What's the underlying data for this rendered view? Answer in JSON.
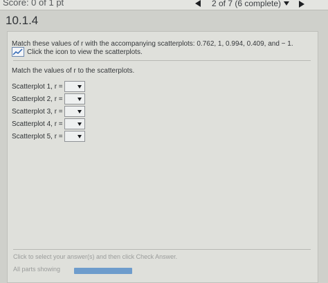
{
  "header": {
    "score_text": "Score: 0 of 1 pt",
    "progress": "2 of 7 (6 complete)"
  },
  "question": {
    "number": "10.1.4",
    "instruction": "Match these values of r with the accompanying scatterplots: 0.762, 1, 0.994, 0.409, and − 1.",
    "icon_label": "Click the icon to view the scatterplots.",
    "match_label": "Match the values of r to the scatterplots.",
    "rows": [
      {
        "label": "Scatterplot 1, r ="
      },
      {
        "label": "Scatterplot 2, r ="
      },
      {
        "label": "Scatterplot 3, r ="
      },
      {
        "label": "Scatterplot 4, r ="
      },
      {
        "label": "Scatterplot 5, r ="
      }
    ]
  },
  "footer": {
    "hint": "Click to select your answer(s) and then click Check Answer.",
    "parts": "All parts showing"
  },
  "icons": {
    "chart": "line-chart-icon",
    "prev": "triangle-left-icon",
    "next": "triangle-right-icon",
    "dropdown": "caret-down-icon"
  }
}
